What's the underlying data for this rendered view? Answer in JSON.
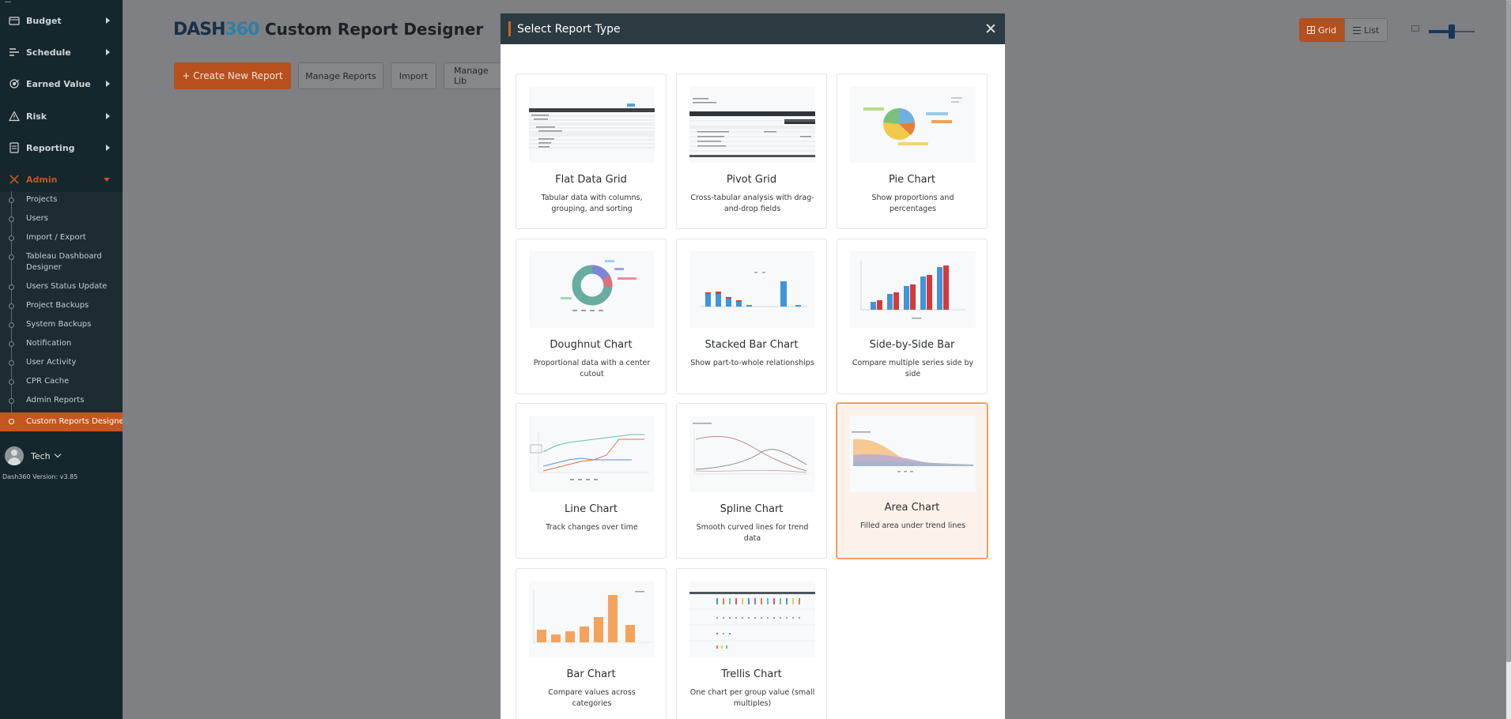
{
  "sidebar": {
    "items": [
      {
        "label": "Budget",
        "icon": "budget-icon"
      },
      {
        "label": "Schedule",
        "icon": "schedule-icon"
      },
      {
        "label": "Earned Value",
        "icon": "earned-value-icon"
      },
      {
        "label": "Risk",
        "icon": "risk-icon"
      },
      {
        "label": "Reporting",
        "icon": "reporting-icon"
      },
      {
        "label": "Admin",
        "icon": "admin-icon"
      }
    ],
    "sub_items": [
      "Projects",
      "Users",
      "Import / Export",
      "Tableau Dashboard Designer",
      "Users Status Update",
      "Project Backups",
      "System Backups",
      "Notification",
      "User Activity",
      "CPR Cache",
      "Admin Reports",
      "Custom Reports Designer"
    ],
    "user": "Tech",
    "version": "Dash360 Version: v3.85"
  },
  "header": {
    "logo_a": "DASH",
    "logo_b": "360",
    "title": "Custom Report Designer",
    "create_label": "+ Create New Report",
    "manage_label": "Manage Reports",
    "import_label": "Import",
    "library_label": "Manage Lib",
    "grid_label": "Grid",
    "list_label": "List",
    "zoom_level": 0.5
  },
  "modal": {
    "title": "Select Report Type",
    "cards": [
      {
        "title": "Flat Data Grid",
        "desc": "Tabular data with columns, grouping, and sorting"
      },
      {
        "title": "Pivot Grid",
        "desc": "Cross-tabular analysis with drag-and-drop fields"
      },
      {
        "title": "Pie Chart",
        "desc": "Show proportions and percentages"
      },
      {
        "title": "Doughnut Chart",
        "desc": "Proportional data with a center cutout"
      },
      {
        "title": "Stacked Bar Chart",
        "desc": "Show part-to-whole relationships"
      },
      {
        "title": "Side-by-Side Bar",
        "desc": "Compare multiple series side by side"
      },
      {
        "title": "Line Chart",
        "desc": "Track changes over time"
      },
      {
        "title": "Spline Chart",
        "desc": "Smooth curved lines for trend data"
      },
      {
        "title": "Area Chart",
        "desc": "Filled area under trend lines"
      },
      {
        "title": "Bar Chart",
        "desc": "Compare values across categories"
      },
      {
        "title": "Trellis Chart",
        "desc": "One chart per group value (small multiples)"
      }
    ],
    "selected_card": "Area Chart"
  },
  "colors": {
    "accent": "#c5561f",
    "sidebar_bg": "#15272c",
    "modal_header": "#2c3b41",
    "selected_card_bg": "#fdf2ea"
  }
}
